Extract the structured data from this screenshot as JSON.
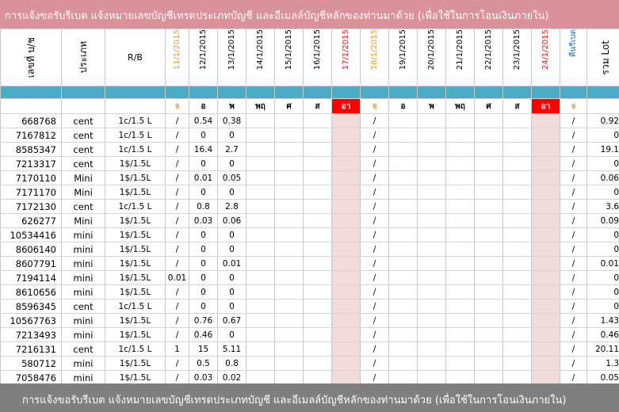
{
  "colors": {
    "top_banner": "#d9929a",
    "bottom_banner": "#7f7f7f",
    "teal_band": "#4bacc6",
    "shade": "#f2dcdb",
    "orange": "#e39b3b",
    "red": "#e02020",
    "blue": "#1f6fb8"
  },
  "banner_top": "การแจ้งขอรับรีเบต   แจ้งหมายเลขบัญชีเทรดประเภทบัญชี และอีเมลล์บัญชีหลักของท่านมาด้วย   (เพื่อใช้ในการโอนเงินภายใน)",
  "banner_bottom": "การแจ้งขอรับรีเบต   แจ้งหมายเลขบัญชีเทรดประเภทบัญชี และอีเมลล์บัญชีหลักของท่านมาด้วย   (เพื่อใช้ในการโอนเงินภายใน)",
  "headers": {
    "account": "เลขที่ บ/ช",
    "type": "ประเภท",
    "rb": "R/B",
    "dates": [
      {
        "label": "11/1/2015",
        "tone": "orange"
      },
      {
        "label": "12/1/2015",
        "tone": ""
      },
      {
        "label": "13/1/2015",
        "tone": ""
      },
      {
        "label": "14/1/2015",
        "tone": ""
      },
      {
        "label": "15/1/2015",
        "tone": ""
      },
      {
        "label": "16/1/2015",
        "tone": ""
      },
      {
        "label": "17/1/2015",
        "tone": "red"
      },
      {
        "label": "18/1/2015",
        "tone": "orange"
      },
      {
        "label": "19/1/2015",
        "tone": ""
      },
      {
        "label": "20/1/2015",
        "tone": ""
      },
      {
        "label": "21/1/2015",
        "tone": ""
      },
      {
        "label": "22/1/2015",
        "tone": ""
      },
      {
        "label": "23/1/2015",
        "tone": ""
      },
      {
        "label": "24/1/2015",
        "tone": "red"
      },
      {
        "label": "คืนรีเบต",
        "tone": "blue"
      }
    ],
    "total": "รวม Lot"
  },
  "days": [
    {
      "label": "จ",
      "style": "orange"
    },
    {
      "label": "อ",
      "style": ""
    },
    {
      "label": "พ",
      "style": ""
    },
    {
      "label": "พฤ",
      "style": ""
    },
    {
      "label": "ศ",
      "style": ""
    },
    {
      "label": "ส",
      "style": ""
    },
    {
      "label": "อา",
      "style": "weekend-red"
    },
    {
      "label": "จ",
      "style": "orange"
    },
    {
      "label": "อ",
      "style": ""
    },
    {
      "label": "พ",
      "style": ""
    },
    {
      "label": "พฤ",
      "style": ""
    },
    {
      "label": "ศ",
      "style": ""
    },
    {
      "label": "ส",
      "style": ""
    },
    {
      "label": "อา",
      "style": "weekend-red"
    },
    {
      "label": "จ",
      "style": "orange"
    }
  ],
  "rows": [
    {
      "account": "668768",
      "type": "cent",
      "rb": "1c/1.5 L",
      "c": [
        "/",
        "0.54",
        "0.38",
        "",
        "",
        "",
        "",
        "/",
        "",
        "",
        "",
        "",
        "",
        "",
        "/"
      ],
      "total": "0.92"
    },
    {
      "account": "7167812",
      "type": "cent",
      "rb": "1c/1.5 L",
      "c": [
        "/",
        "0",
        "0",
        "",
        "",
        "",
        "",
        "/",
        "",
        "",
        "",
        "",
        "",
        "",
        "/"
      ],
      "total": "0"
    },
    {
      "account": "8585347",
      "type": "cent",
      "rb": "1c/1.5 L",
      "c": [
        "/",
        "16.4",
        "2.7",
        "",
        "",
        "",
        "",
        "/",
        "",
        "",
        "",
        "",
        "",
        "",
        "/"
      ],
      "total": "19.1"
    },
    {
      "account": "7213317",
      "type": "cent",
      "rb": "1$/1.5L",
      "c": [
        "/",
        "0",
        "0",
        "",
        "",
        "",
        "",
        "/",
        "",
        "",
        "",
        "",
        "",
        "",
        "/"
      ],
      "total": "0"
    },
    {
      "account": "7170110",
      "type": "Mini",
      "rb": "1$/1.5L",
      "c": [
        "/",
        "0.01",
        "0.05",
        "",
        "",
        "",
        "",
        "/",
        "",
        "",
        "",
        "",
        "",
        "",
        "/"
      ],
      "total": "0.06"
    },
    {
      "account": "7171170",
      "type": "Mini",
      "rb": "1$/1.5L",
      "c": [
        "/",
        "0",
        "0",
        "",
        "",
        "",
        "",
        "/",
        "",
        "",
        "",
        "",
        "",
        "",
        "/"
      ],
      "total": "0"
    },
    {
      "account": "7172130",
      "type": "cent",
      "rb": "1c/1.5 L",
      "c": [
        "/",
        "0.8",
        "2.8",
        "",
        "",
        "",
        "",
        "/",
        "",
        "",
        "",
        "",
        "",
        "",
        "/"
      ],
      "total": "3.6"
    },
    {
      "account": "626277",
      "type": "Mini",
      "rb": "1$/1.5L",
      "c": [
        "/",
        "0.03",
        "0.06",
        "",
        "",
        "",
        "",
        "/",
        "",
        "",
        "",
        "",
        "",
        "",
        "/"
      ],
      "total": "0.09"
    },
    {
      "account": "10534416",
      "type": "mini",
      "rb": "1$/1.5L",
      "c": [
        "/",
        "0",
        "0",
        "",
        "",
        "",
        "",
        "/",
        "",
        "",
        "",
        "",
        "",
        "",
        "/"
      ],
      "total": "0"
    },
    {
      "account": "8606140",
      "type": "mini",
      "rb": "1$/1.5L",
      "c": [
        "/",
        "0",
        "0",
        "",
        "",
        "",
        "",
        "/",
        "",
        "",
        "",
        "",
        "",
        "",
        "/"
      ],
      "total": "0"
    },
    {
      "account": "8607791",
      "type": "mini",
      "rb": "1$/1.5L",
      "c": [
        "/",
        "0",
        "0.01",
        "",
        "",
        "",
        "",
        "/",
        "",
        "",
        "",
        "",
        "",
        "",
        "/"
      ],
      "total": "0.01"
    },
    {
      "account": "7194114",
      "type": "mini",
      "rb": "1$/1.5L",
      "c": [
        "0.01",
        "0",
        "0",
        "",
        "",
        "",
        "",
        "/",
        "",
        "",
        "",
        "",
        "",
        "",
        "/"
      ],
      "total": "0"
    },
    {
      "account": "8610656",
      "type": "mini",
      "rb": "1$/1.5L",
      "c": [
        "/",
        "0",
        "0",
        "",
        "",
        "",
        "",
        "/",
        "",
        "",
        "",
        "",
        "",
        "",
        "/"
      ],
      "total": "0"
    },
    {
      "account": "8596345",
      "type": "cent",
      "rb": "1c/1.5 L",
      "c": [
        "/",
        "0",
        "0",
        "",
        "",
        "",
        "",
        "/",
        "",
        "",
        "",
        "",
        "",
        "",
        "/"
      ],
      "total": "0"
    },
    {
      "account": "10567763",
      "type": "mini",
      "rb": "1$/1.5L",
      "c": [
        "/",
        "0.76",
        "0.67",
        "",
        "",
        "",
        "",
        "/",
        "",
        "",
        "",
        "",
        "",
        "",
        "/"
      ],
      "total": "1.43"
    },
    {
      "account": "7213493",
      "type": "mini",
      "rb": "1$/1.5L",
      "c": [
        "/",
        "0.46",
        "0",
        "",
        "",
        "",
        "",
        "/",
        "",
        "",
        "",
        "",
        "",
        "",
        "/"
      ],
      "total": "0.46"
    },
    {
      "account": "7216131",
      "type": "cent",
      "rb": "1c/1.5 L",
      "c": [
        "1",
        "15",
        "5.11",
        "",
        "",
        "",
        "",
        "/",
        "",
        "",
        "",
        "",
        "",
        "",
        "/"
      ],
      "total": "20.11"
    },
    {
      "account": "580712",
      "type": "mini",
      "rb": "1$/1.5L",
      "c": [
        "/",
        "0.5",
        "0.8",
        "",
        "",
        "",
        "",
        "/",
        "",
        "",
        "",
        "",
        "",
        "",
        "/"
      ],
      "total": "1.3"
    },
    {
      "account": "7058476",
      "type": "mini",
      "rb": "1$/1.5L",
      "c": [
        "/",
        "0.03",
        "0.02",
        "",
        "",
        "",
        "",
        "/",
        "",
        "",
        "",
        "",
        "",
        "",
        "/"
      ],
      "total": "0.05"
    }
  ]
}
